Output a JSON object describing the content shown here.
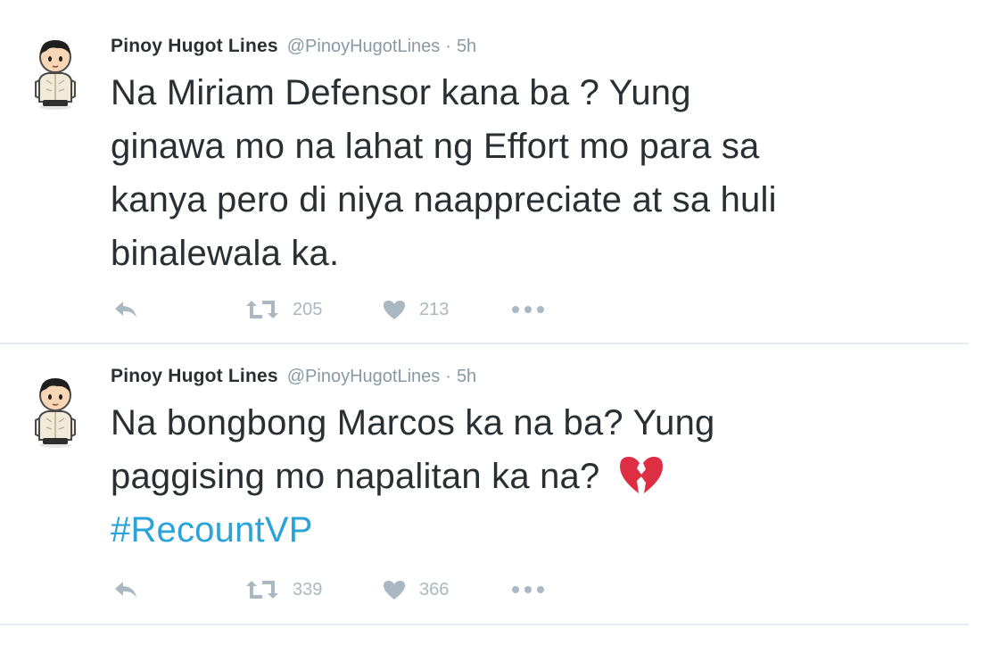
{
  "tweets": [
    {
      "user_name": "Pinoy Hugot Lines",
      "handle": "@PinoyHugotLines",
      "separator": "·",
      "time": "5h",
      "text_lines": [
        "Na Miriam Defensor kana ba ? Yung",
        "ginawa mo na lahat ng Effort mo para sa",
        "kanya pero di niya naappreciate at sa huli",
        "binalewala ka."
      ],
      "retweets": "205",
      "likes": "213"
    },
    {
      "user_name": "Pinoy Hugot Lines",
      "handle": "@PinoyHugotLines",
      "separator": "·",
      "time": "5h",
      "text_lines": [
        "Na bongbong Marcos ka na ba? Yung",
        "paggising mo napalitan ka na?"
      ],
      "emoji": "broken-heart-icon",
      "hashtag": "#RecountVP",
      "retweets": "339",
      "likes": "366"
    }
  ],
  "colors": {
    "text": "#292f33",
    "muted": "#8899a6",
    "action": "#aab8c2",
    "hashtag": "#2aa3d8",
    "divider": "#e6ecf0",
    "broken_heart": "#dd2e44"
  }
}
